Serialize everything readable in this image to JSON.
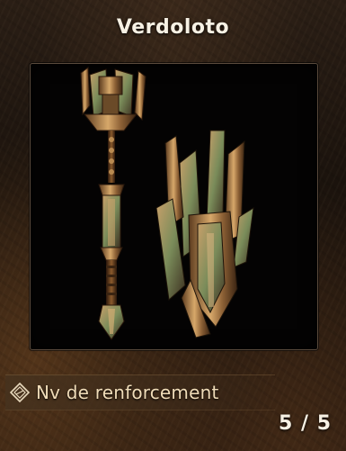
{
  "item": {
    "name": "Verdoloto"
  },
  "stat": {
    "icon": "reinforcement-level-icon",
    "label": "Nv de renforcement"
  },
  "counter": {
    "text": "5 / 5"
  },
  "colors": {
    "title": "#f7f1e4",
    "frame_border": "#5a4a3c",
    "label": "#f0dcb8",
    "metal_gold": "#c79a5a",
    "metal_green": "#6f8a58"
  }
}
